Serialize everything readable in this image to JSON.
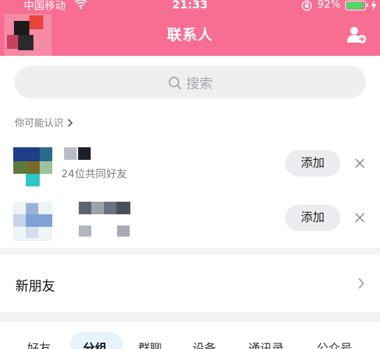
{
  "status_bar": {
    "carrier": "中国移动",
    "time": "21:33",
    "battery_percent": "92%",
    "battery_level": 0.92
  },
  "header": {
    "title": "联系人",
    "add_contact_icon": "add-contact-icon"
  },
  "search": {
    "placeholder": "搜索"
  },
  "suggestions": {
    "header": "你可能认识",
    "items": [
      {
        "subtitle": "24位共同好友",
        "add_label": "添加"
      },
      {
        "subtitle": "",
        "add_label": "添加"
      }
    ]
  },
  "new_friends": {
    "label": "新朋友"
  },
  "tabs": [
    {
      "label": "好友"
    },
    {
      "label": "分组",
      "active": true
    },
    {
      "label": "群聊"
    },
    {
      "label": "设备"
    },
    {
      "label": "通讯录"
    },
    {
      "label": "公众号"
    }
  ],
  "colors": {
    "accent": "#f76e92",
    "active_tab_bg": "#e6f3fa",
    "battery_fill": "#4fd964"
  }
}
